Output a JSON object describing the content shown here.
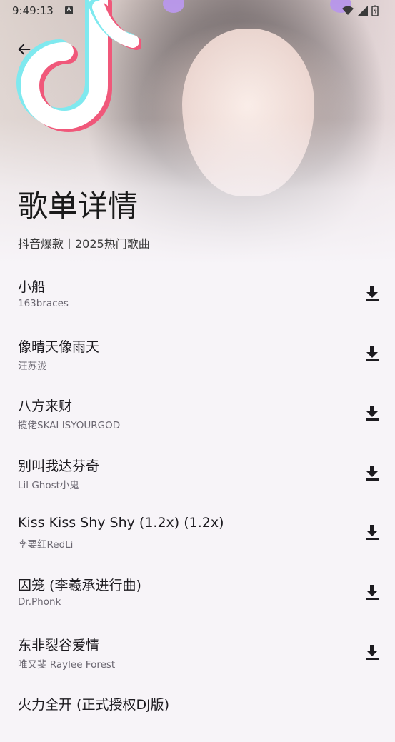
{
  "status_bar": {
    "time": "9:49:13",
    "notification_badge": "A",
    "icons": [
      "wifi-icon",
      "signal-icon",
      "battery-icon"
    ]
  },
  "header": {
    "back_icon": "arrow-left-icon",
    "logo": "tiktok-logo",
    "title": "歌单详情",
    "subtitle": "抖音爆款丨2025热门歌曲"
  },
  "songs": [
    {
      "title": "小船",
      "artist": "163braces"
    },
    {
      "title": "像晴天像雨天",
      "artist": "汪苏泷"
    },
    {
      "title": "八方来财",
      "artist": "揽佬SKAI ISYOURGOD"
    },
    {
      "title": "别叫我达芬奇",
      "artist": "Lil Ghost小鬼"
    },
    {
      "title": "Kiss Kiss Shy Shy (1.2x) (1.2x)",
      "artist": "李要红RedLi"
    },
    {
      "title": "囚笼 (李羲承进行曲)",
      "artist": "Dr.Phonk"
    },
    {
      "title": "东非裂谷爱情",
      "artist": "唯又斐 Raylee Forest"
    },
    {
      "title": "火力全开 (正式授权DJ版)",
      "artist": ""
    }
  ],
  "colors": {
    "background": "#f7f4f8",
    "text_primary": "#1d1b20",
    "text_secondary": "#6a6670",
    "logo_cyan": "#7fe9ef",
    "logo_pink": "#f0587a"
  }
}
